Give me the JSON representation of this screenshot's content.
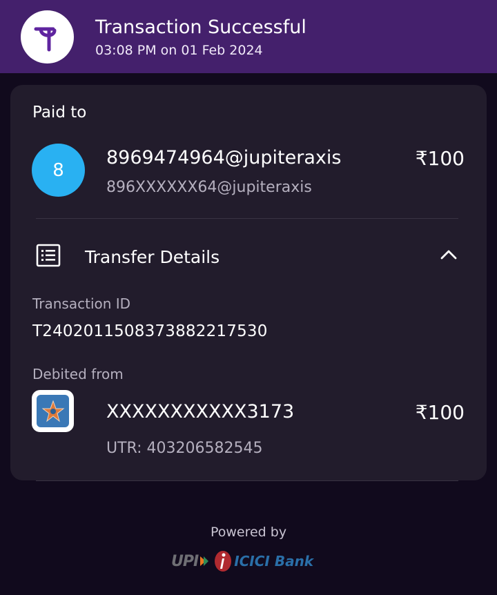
{
  "header": {
    "logo_glyph": "पे",
    "title": "Transaction Successful",
    "subtitle": "03:08 PM on 01 Feb 2024",
    "color": "#44206c"
  },
  "payee": {
    "section_label": "Paid to",
    "avatar_initial": "8",
    "avatar_color": "#29b1f2",
    "upi_id": "8969474964@jupiteraxis",
    "masked_upi_id": "896XXXXXX64@jupiteraxis",
    "amount": "₹100"
  },
  "transfer_details": {
    "title": "Transfer Details",
    "icon": "list-icon",
    "toggle_icon": "chevron-up-icon",
    "transaction_id_label": "Transaction ID",
    "transaction_id": "T2402011508373882217530",
    "debited_from_label": "Debited from",
    "bank_icon": "bank-logo",
    "account": "XXXXXXXXXXX3173",
    "amount": "₹100",
    "utr": "UTR: 403206582545"
  },
  "footer": {
    "powered_by": "Powered by",
    "upi_logo": "UPI",
    "bank_logo": "ICICI Bank"
  }
}
